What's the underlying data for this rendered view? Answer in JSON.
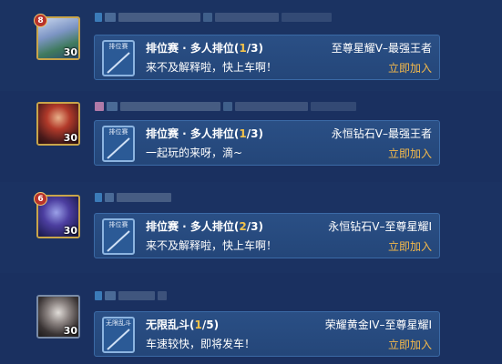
{
  "colors": {
    "background": "#1a3160",
    "card": "#244679",
    "highlight": "#f3c24a",
    "join": "#f3b84a",
    "text": "#ffffff"
  },
  "messages": [
    {
      "avatar_icon": "player-avatar",
      "avatar_level": "30",
      "rank_badge": "8",
      "card_icon_label": "排位赛",
      "card_icon": "ranked-match-icon",
      "title_prefix": "排位赛 · 多人排位(",
      "count_current": "1",
      "count_total": "/3)",
      "message": "来不及解释啦，快上车啊！",
      "rank_range": "至尊星耀V–最强王者",
      "join_label": "立即加入"
    },
    {
      "avatar_icon": "player-avatar",
      "avatar_level": "30",
      "rank_badge": "",
      "card_icon_label": "排位赛",
      "card_icon": "ranked-match-icon",
      "title_prefix": "排位赛 · 多人排位(",
      "count_current": "1",
      "count_total": "/3)",
      "message": "一起玩的来呀，滴~",
      "rank_range": "永恒钻石V–最强王者",
      "join_label": "立即加入"
    },
    {
      "avatar_icon": "player-avatar",
      "avatar_level": "30",
      "rank_badge": "6",
      "card_icon_label": "排位赛",
      "card_icon": "ranked-match-icon",
      "title_prefix": "排位赛 · 多人排位(",
      "count_current": "2",
      "count_total": "/3)",
      "message": "来不及解释啦，快上车啊！",
      "rank_range": "永恒钻石V–至尊星耀I",
      "join_label": "立即加入"
    },
    {
      "avatar_icon": "player-avatar",
      "avatar_level": "30",
      "rank_badge": "",
      "card_icon_label": "无限乱斗",
      "card_icon": "infinite-brawl-icon",
      "title_prefix": "无限乱斗(",
      "count_current": "1",
      "count_total": "/5)",
      "message": "车速较快，即将发车！",
      "rank_range": "荣耀黄金IV–至尊星耀I",
      "join_label": "立即加入"
    }
  ]
}
